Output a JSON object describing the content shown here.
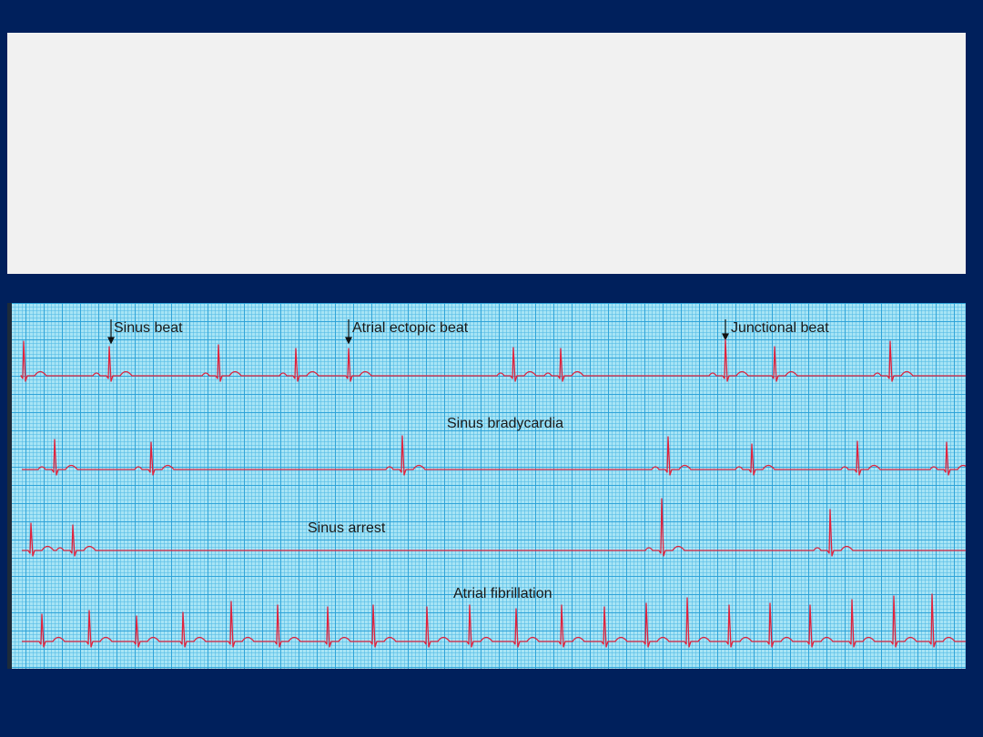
{
  "labels": {
    "sinus_beat": "Sinus beat",
    "atrial_ectopic_beat": "Atrial ectopic beat",
    "junctional_beat": "Junctional beat",
    "sinus_bradycardia": "Sinus bradycardia",
    "sinus_arrest": "Sinus arrest",
    "atrial_fibrillation": "Atrial fibrillation"
  },
  "colors": {
    "background": "#00205c",
    "top_panel": "#f1f1f1",
    "ecg_paper": "#a7e4f5",
    "ecg_trace": "#e0223c"
  }
}
